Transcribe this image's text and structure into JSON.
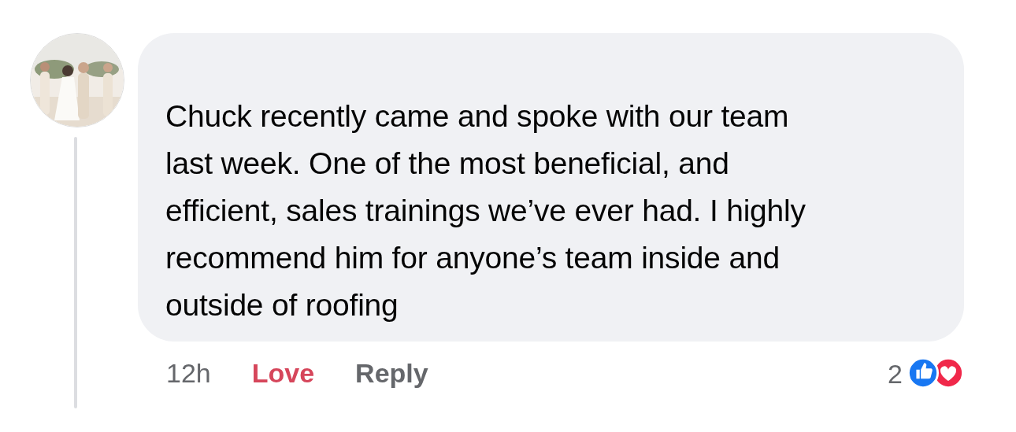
{
  "comment": {
    "text": "Chuck recently came and spoke with our team\nlast week. One of the most beneficial, and\nefficient, sales trainings we’ve ever had. I highly\nrecommend him for anyone’s team inside and\noutside of roofing",
    "time": "12h",
    "actions": [
      {
        "kind": "reaction",
        "label": "Love",
        "selected": true
      },
      {
        "kind": "reply",
        "label": "Reply",
        "selected": false
      }
    ],
    "reaction_count": "2",
    "reactions": [
      {
        "kind": "like",
        "color": "#1877f2"
      },
      {
        "kind": "love",
        "color": "#f0284a"
      }
    ]
  }
}
